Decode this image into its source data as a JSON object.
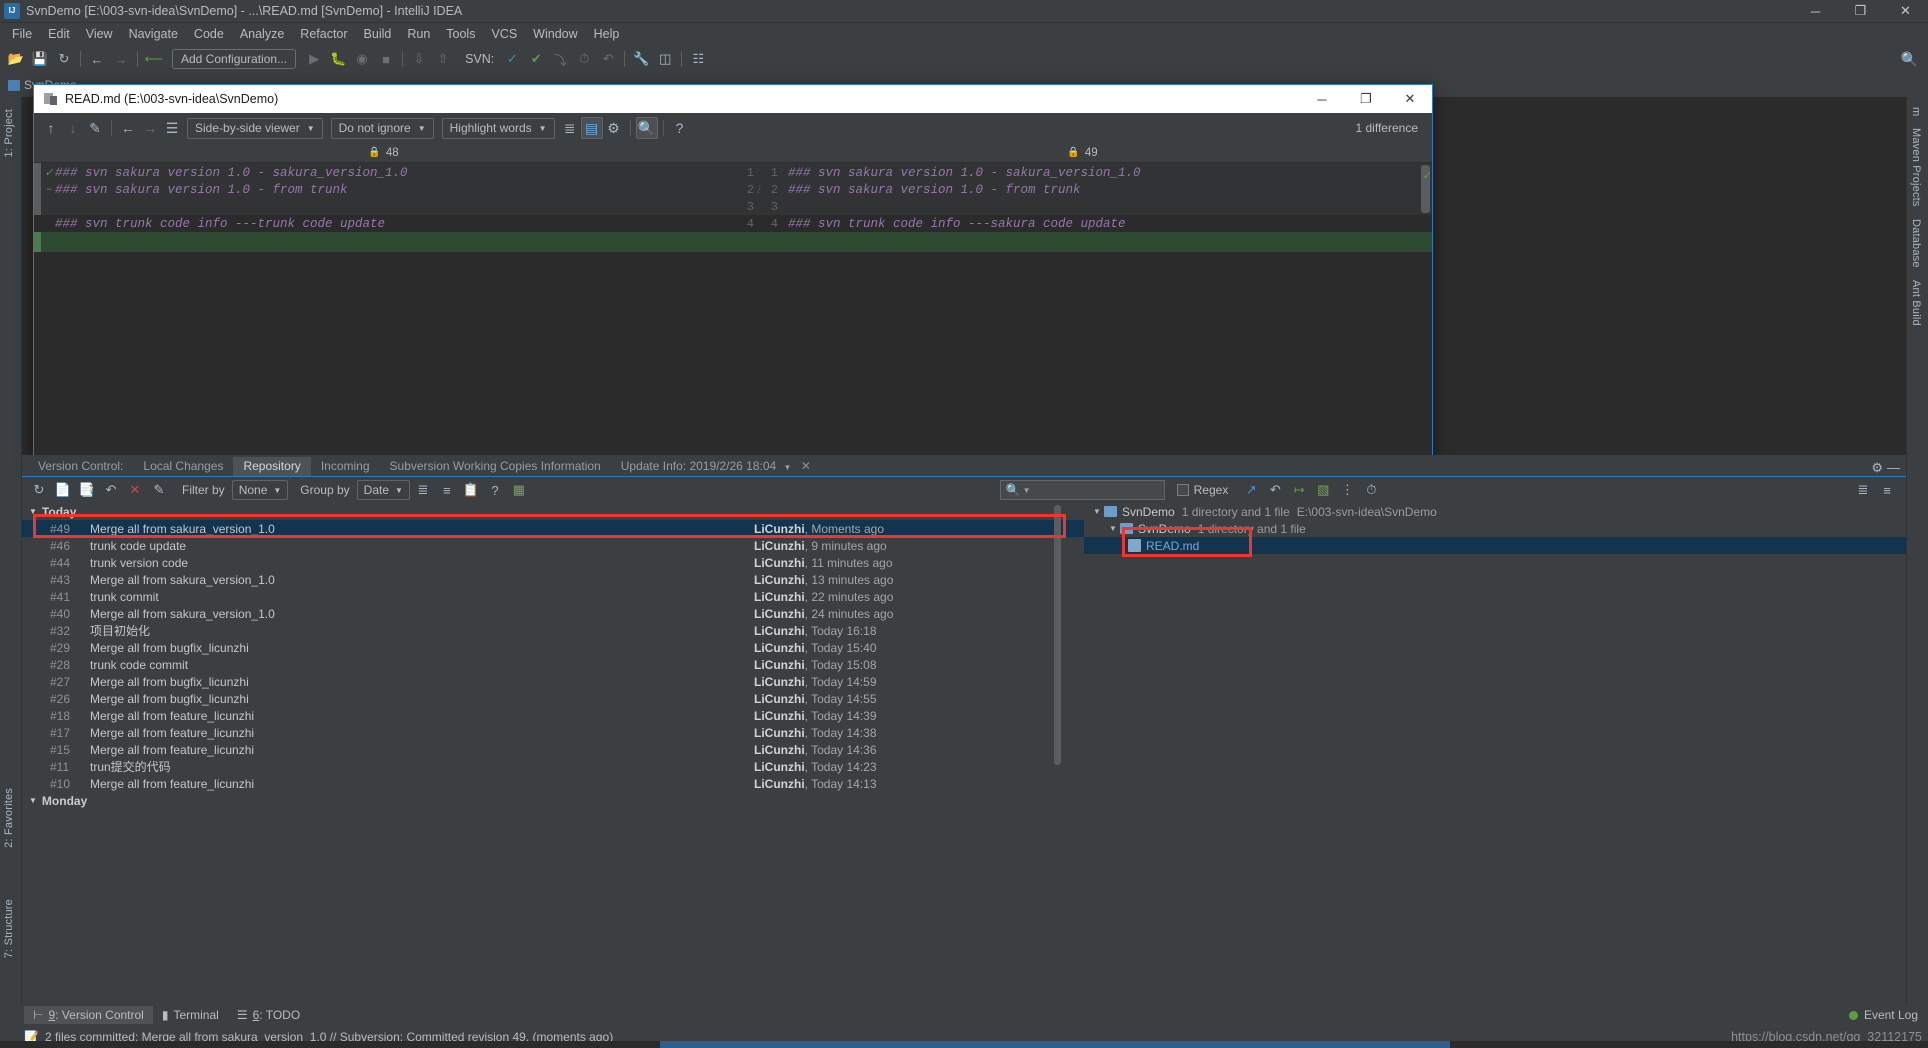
{
  "window": {
    "title": "SvnDemo [E:\\003-svn-idea\\SvnDemo] - ...\\READ.md [SvnDemo] - IntelliJ IDEA",
    "minimize": "─",
    "maximize": "❐",
    "close": "✕"
  },
  "menu": [
    "File",
    "Edit",
    "View",
    "Navigate",
    "Code",
    "Analyze",
    "Refactor",
    "Build",
    "Run",
    "Tools",
    "VCS",
    "Window",
    "Help"
  ],
  "toolbar": {
    "add_configuration": "Add Configuration...",
    "svn_label": "SVN:"
  },
  "breadcrumb": {
    "project": "SvnDemo"
  },
  "left_stripe": [
    "1: Project",
    "2: Favorites",
    "7: Structure"
  ],
  "right_stripe": [
    "m",
    "Maven Projects",
    "Database",
    "Ant Build"
  ],
  "diff_dialog": {
    "title": "READ.md (E:\\003-svn-idea\\SvnDemo)",
    "minimize": "─",
    "maximize": "❐",
    "close": "✕",
    "viewer_mode": "Side-by-side viewer",
    "ignore_mode": "Do not ignore",
    "highlight_mode": "Highlight words",
    "difference_count": "1 difference",
    "left_revision": "48",
    "right_revision": "49",
    "left_lines": [
      {
        "num": "",
        "text": "### svn sakura version 1.0 - sakura_version_1.0"
      },
      {
        "num": "",
        "text": "### svn sakura version 1.0 - from trunk"
      },
      {
        "num": "",
        "text": ""
      },
      {
        "num": "",
        "text": "### svn trunk code info ---trunk code update"
      }
    ],
    "right_lines": [
      {
        "num": "1",
        "num2": "1",
        "text": "### svn sakura version 1.0 - sakura_version_1.0"
      },
      {
        "num": "2",
        "num2": "2",
        "text": "### svn sakura version 1.0 - from trunk"
      },
      {
        "num": "3",
        "num2": "3",
        "text": ""
      },
      {
        "num": "4",
        "num2": "4",
        "text": "### svn trunk code info ---sakura code update"
      }
    ]
  },
  "vc_tabs": [
    {
      "label": "Version Control:",
      "active": false
    },
    {
      "label": "Local Changes",
      "active": false
    },
    {
      "label": "Repository",
      "active": true
    },
    {
      "label": "Incoming",
      "active": false
    },
    {
      "label": "Subversion Working Copies Information",
      "active": false
    },
    {
      "label": "Update Info: 2019/2/26 18:04",
      "active": false,
      "has_caret": true,
      "has_close": true
    }
  ],
  "vc_toolbar": {
    "filter_by_label": "Filter by",
    "filter_by_value": "None",
    "group_by_label": "Group by",
    "group_by_value": "Date",
    "search_placeholder": "",
    "regex_label": "Regex"
  },
  "log": {
    "groups": [
      {
        "name": "Today",
        "rows": [
          {
            "rev": "#49",
            "msg": "Merge all from sakura_version_1.0",
            "author": "LiCunzhi",
            "time": ", Moments ago",
            "selected": true
          },
          {
            "rev": "#46",
            "msg": "trunk code update",
            "author": "LiCunzhi",
            "time": ", 9 minutes ago",
            "selected": false
          },
          {
            "rev": "#44",
            "msg": "trunk version code",
            "author": "LiCunzhi",
            "time": ", 11 minutes ago",
            "selected": false
          },
          {
            "rev": "#43",
            "msg": "Merge all from sakura_version_1.0",
            "author": "LiCunzhi",
            "time": ", 13 minutes ago",
            "selected": false
          },
          {
            "rev": "#41",
            "msg": "trunk commit",
            "author": "LiCunzhi",
            "time": ", 22 minutes ago",
            "selected": false
          },
          {
            "rev": "#40",
            "msg": "Merge all from sakura_version_1.0",
            "author": "LiCunzhi",
            "time": ", 24 minutes ago",
            "selected": false
          },
          {
            "rev": "#32",
            "msg": "项目初始化",
            "author": "LiCunzhi",
            "time": ", Today 16:18",
            "selected": false
          },
          {
            "rev": "#29",
            "msg": "Merge all from bugfix_licunzhi",
            "author": "LiCunzhi",
            "time": ", Today 15:40",
            "selected": false
          },
          {
            "rev": "#28",
            "msg": "trunk code commit",
            "author": "LiCunzhi",
            "time": ", Today 15:08",
            "selected": false
          },
          {
            "rev": "#27",
            "msg": "Merge all from bugfix_licunzhi",
            "author": "LiCunzhi",
            "time": ", Today 14:59",
            "selected": false
          },
          {
            "rev": "#26",
            "msg": "Merge all from bugfix_licunzhi",
            "author": "LiCunzhi",
            "time": ", Today 14:55",
            "selected": false
          },
          {
            "rev": "#18",
            "msg": "Merge all from feature_licunzhi",
            "author": "LiCunzhi",
            "time": ", Today 14:39",
            "selected": false
          },
          {
            "rev": "#17",
            "msg": "Merge all from feature_licunzhi",
            "author": "LiCunzhi",
            "time": ", Today 14:38",
            "selected": false
          },
          {
            "rev": "#15",
            "msg": "Merge all from feature_licunzhi",
            "author": "LiCunzhi",
            "time": ", Today 14:36",
            "selected": false
          },
          {
            "rev": "#11",
            "msg": "trun提交的代码",
            "author": "LiCunzhi",
            "time": ", Today 14:23",
            "selected": false
          },
          {
            "rev": "#10",
            "msg": "Merge all from feature_licunzhi",
            "author": "LiCunzhi",
            "time": ", Today 14:13",
            "selected": false
          }
        ]
      },
      {
        "name": "Monday",
        "rows": []
      }
    ]
  },
  "file_tree": [
    {
      "indent": 0,
      "arrow": "▼",
      "icon": "folder-icon",
      "name": "SvnDemo",
      "sub": "1 directory and 1 file",
      "path": "E:\\003-svn-idea\\SvnDemo",
      "selected": false
    },
    {
      "indent": 1,
      "arrow": "▼",
      "icon": "folder-icon",
      "name": "SvnDemo",
      "sub": "1 directory and 1 file",
      "path": "",
      "selected": false
    },
    {
      "indent": 2,
      "arrow": "",
      "icon": "md-file-icon",
      "name": "READ.md",
      "sub": "",
      "path": "",
      "selected": true
    }
  ],
  "bottom_tabs": [
    {
      "num": "9",
      "label": ": Version Control",
      "active": true
    },
    {
      "num": "",
      "label": "Terminal",
      "active": false
    },
    {
      "num": "6",
      "label": ": TODO",
      "active": false
    }
  ],
  "bottom_right": {
    "event_log": "Event Log"
  },
  "status": {
    "message": "2 files committed: Merge all from sakura_version_1.0 // Subversion: Committed revision 49. (moments ago)",
    "watermark": "https://blog.csdn.net/qq_32112175"
  },
  "colors": {
    "accent_blue": "#2d7bbd",
    "selection": "#13344f",
    "annotation_red": "#f3342c",
    "code_purple": "#9876aa",
    "diff_green": "#2f4a33"
  }
}
